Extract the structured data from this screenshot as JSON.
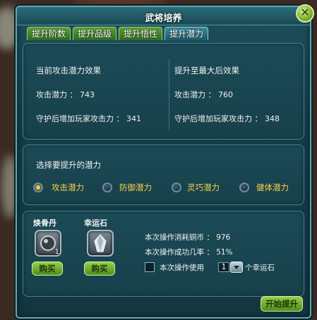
{
  "window": {
    "title": "武将培养"
  },
  "tabs": [
    {
      "label": "提升阶数",
      "active": false
    },
    {
      "label": "提升品级",
      "active": false
    },
    {
      "label": "提升悟性",
      "active": false
    },
    {
      "label": "提升潜力",
      "active": true
    }
  ],
  "current": {
    "heading": "当前攻击潜力效果",
    "potential_label": "攻击潜力",
    "potential_value": "743",
    "guard_label": "守护后增加玩家攻击力",
    "guard_value": "341"
  },
  "maxed": {
    "heading": "提升至最大后效果",
    "potential_label": "攻击潜力",
    "potential_value": "760",
    "guard_label": "守护后增加玩家攻击力",
    "guard_value": "348"
  },
  "select": {
    "heading": "选择要提升的潜力",
    "options": [
      {
        "label": "攻击潜力",
        "selected": true
      },
      {
        "label": "防御潜力",
        "selected": false
      },
      {
        "label": "灵巧潜力",
        "selected": false
      },
      {
        "label": "健体潜力",
        "selected": false
      }
    ]
  },
  "items": [
    {
      "name": "焕骨丹",
      "count": "1",
      "buy_label": "购买",
      "icon": "pearl-icon"
    },
    {
      "name": "幸运石",
      "count": "",
      "buy_label": "购买",
      "icon": "crystal-icon"
    }
  ],
  "operation": {
    "cost_label": "本次操作消耗铜币",
    "cost_value": "976",
    "rate_label": "本次操作成功几率",
    "rate_value": "51%",
    "use_prefix": "本次操作使用",
    "use_count": "1",
    "use_suffix": "个幸运石",
    "start_label": "开始提升"
  },
  "colors": {
    "accent_gold": "#f6d24a",
    "button_green": "#6aa51f",
    "panel_teal": "#1b4a56"
  }
}
